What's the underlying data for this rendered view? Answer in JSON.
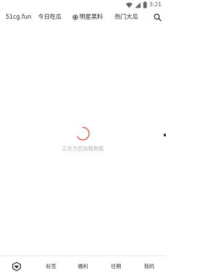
{
  "status_bar": {
    "time": "3:21",
    "icons": [
      "wifi-icon",
      "signal-icon",
      "battery-icon"
    ]
  },
  "top_tabs": {
    "site": "51cg.fun",
    "items": [
      {
        "label": "今日吃瓜",
        "icon": null
      },
      {
        "label": "明星黑料",
        "icon": "target-icon"
      },
      {
        "label": "热门大瓜",
        "icon": null
      }
    ]
  },
  "loading": {
    "text": "正在为您加载数据",
    "spinner_color": "#e0544a"
  },
  "bottom_nav": {
    "items": [
      {
        "label": "",
        "icon": "home-shield-icon"
      },
      {
        "label": "标签"
      },
      {
        "label": "福利"
      },
      {
        "label": "往期"
      },
      {
        "label": "我的"
      }
    ]
  }
}
